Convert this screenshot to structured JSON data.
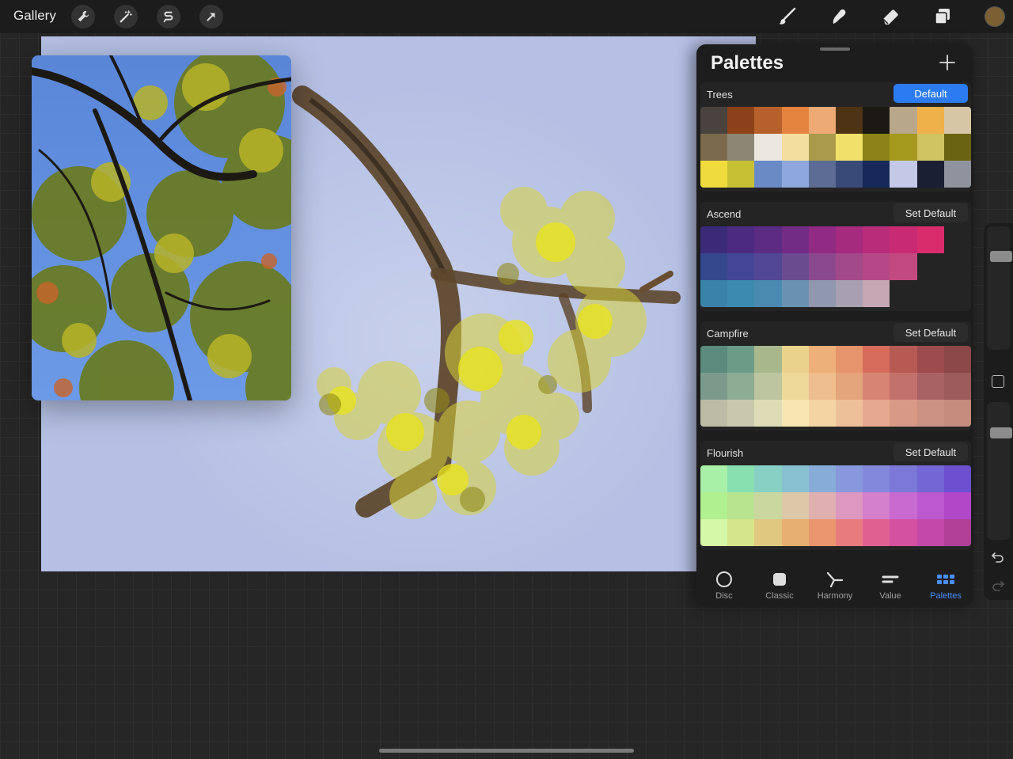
{
  "topbar": {
    "gallery_label": "Gallery",
    "left_tools": [
      "wrench-icon",
      "magic-wand-icon",
      "selection-icon",
      "transform-arrow-icon"
    ],
    "right_tools": [
      "brush-icon",
      "smudge-icon",
      "eraser-icon",
      "layers-icon"
    ],
    "current_color": "#7a6032"
  },
  "palettes": {
    "title": "Palettes",
    "items": [
      {
        "name": "Trees",
        "button": "Default",
        "is_default": true,
        "colors": [
          "#4a423e",
          "#8c4119",
          "#b6612b",
          "#e4843e",
          "#eeaa74",
          "#4e3414",
          "#1c1915",
          "#b9a78a",
          "#efb14a",
          "#d6c6a6",
          "#7b6a4b",
          "#8b8774",
          "#ebe6de",
          "#f3dea0",
          "#a99a4c",
          "#f1e16a",
          "#8b8219",
          "#a59a1e",
          "#d0c362",
          "#6a6310",
          "#efdc3c",
          "#c7bf33",
          "#6a8ac6",
          "#8ea8de",
          "#5c6c94",
          "#394a78",
          "#17295a",
          "#c3c9e7",
          "#1b1f33",
          "#8f939d"
        ]
      },
      {
        "name": "Ascend",
        "button": "Set Default",
        "is_default": false,
        "colors": [
          "#3a2a78",
          "#4b2a80",
          "#5c2b84",
          "#722c86",
          "#902a82",
          "#a42b7e",
          "#b82c7a",
          "#c82b74",
          "#d82c6c",
          "#242424",
          "#35488e",
          "#434694",
          "#524794",
          "#6a4b90",
          "#8a498e",
          "#a2498a",
          "#b44986",
          "#c24a80",
          "#242424",
          "#242424",
          "#3a82a8",
          "#3c8aae",
          "#4a8ab0",
          "#6a92b0",
          "#9098ae",
          "#a8a0b0",
          "#c6a6b2",
          "#242424",
          "#242424",
          "#242424"
        ]
      },
      {
        "name": "Campfire",
        "button": "Set Default",
        "is_default": false,
        "colors": [
          "#5c8a7c",
          "#6c9c88",
          "#a8b88c",
          "#ead28c",
          "#ecb078",
          "#e6946c",
          "#d86c5c",
          "#b85a54",
          "#9c4c4c",
          "#8c4848",
          "#7c9a8c",
          "#8cac94",
          "#bcc4a0",
          "#eed89a",
          "#eebe8c",
          "#e4a47c",
          "#d88474",
          "#c2726c",
          "#a86264",
          "#9c5c5c",
          "#bcbca6",
          "#c8c8ac",
          "#dedcb6",
          "#f6e6b2",
          "#f4d4a2",
          "#eec09a",
          "#e6a88e",
          "#d89a86",
          "#cc9282",
          "#c68c7c"
        ]
      },
      {
        "name": "Flourish",
        "button": "Set Default",
        "is_default": false,
        "colors": [
          "#a8f0a8",
          "#88e0b0",
          "#88d0c4",
          "#88c0d0",
          "#88acd8",
          "#8898dc",
          "#8488da",
          "#7c78d8",
          "#7466d4",
          "#6c50d0",
          "#b0f090",
          "#b8e490",
          "#cad8a0",
          "#dcc8a8",
          "#e0b0b0",
          "#dc98c0",
          "#d480cc",
          "#c86ad0",
          "#bc58d0",
          "#b048c8",
          "#d4f8a8",
          "#d4e488",
          "#e0c880",
          "#e8b070",
          "#ec9670",
          "#e87c7c",
          "#e06090",
          "#d450a0",
          "#c448a8",
          "#b04098"
        ]
      }
    ]
  },
  "tabs": [
    {
      "label": "Disc",
      "icon": "disc-icon"
    },
    {
      "label": "Classic",
      "icon": "classic-square-icon"
    },
    {
      "label": "Harmony",
      "icon": "harmony-icon"
    },
    {
      "label": "Value",
      "icon": "value-sliders-icon"
    },
    {
      "label": "Palettes",
      "icon": "palettes-grid-icon",
      "active": true
    }
  ],
  "sidebar": {
    "brush_size": 0.22,
    "opacity": 0.2
  }
}
